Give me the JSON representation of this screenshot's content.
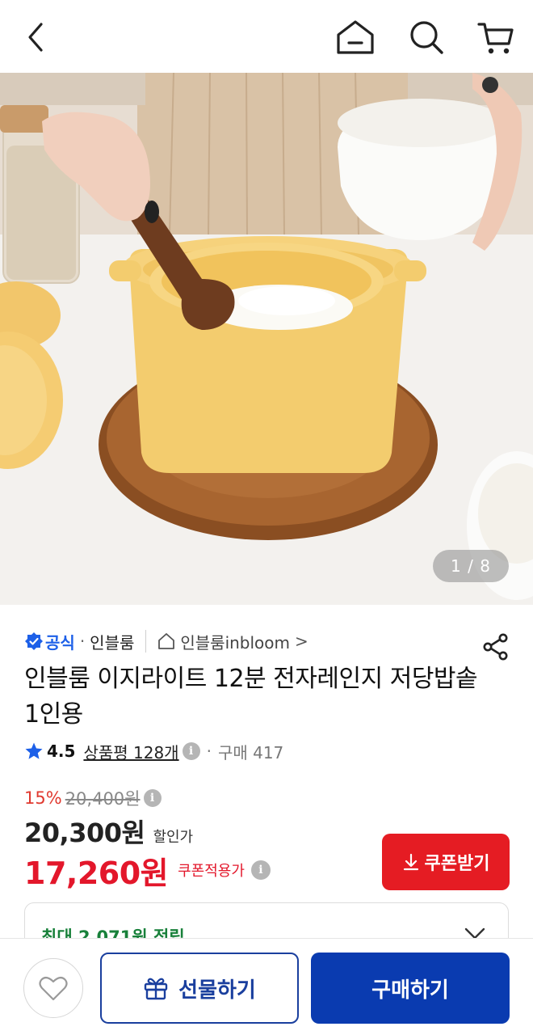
{
  "header": {
    "back_icon": "chevron-left-icon",
    "home_icon": "home-icon",
    "search_icon": "search-icon",
    "cart_icon": "cart-icon"
  },
  "gallery": {
    "counter": "1 / 8"
  },
  "seller": {
    "official_label": "공식",
    "separator": "·",
    "brand_name": "인블룸",
    "store_name": "인블룸inbloom",
    "store_chevron": ">"
  },
  "product": {
    "title": "인블룸 이지라이트 12분 전자레인지 저당밥솥 1인용"
  },
  "rating": {
    "score": "4.5",
    "reviews": "상품평 128개",
    "separator": "·",
    "sales": "구매 417",
    "star_color": "#1d60e8"
  },
  "pricing": {
    "discount_percent": "15%",
    "original_price": "20,400원",
    "sale_price": "20,300원",
    "sale_price_label": "할인가",
    "coupon_price": "17,260원",
    "coupon_price_label": "쿠폰적용가",
    "coupon_button": "쿠폰받기",
    "coupon_color": "#e51c23"
  },
  "points": {
    "text": "최대 2,071원 적립"
  },
  "bottom_bar": {
    "wishlist_icon": "heart-icon",
    "gift_label": "선물하기",
    "buy_label": "구매하기",
    "primary_color": "#0a3bb0"
  }
}
